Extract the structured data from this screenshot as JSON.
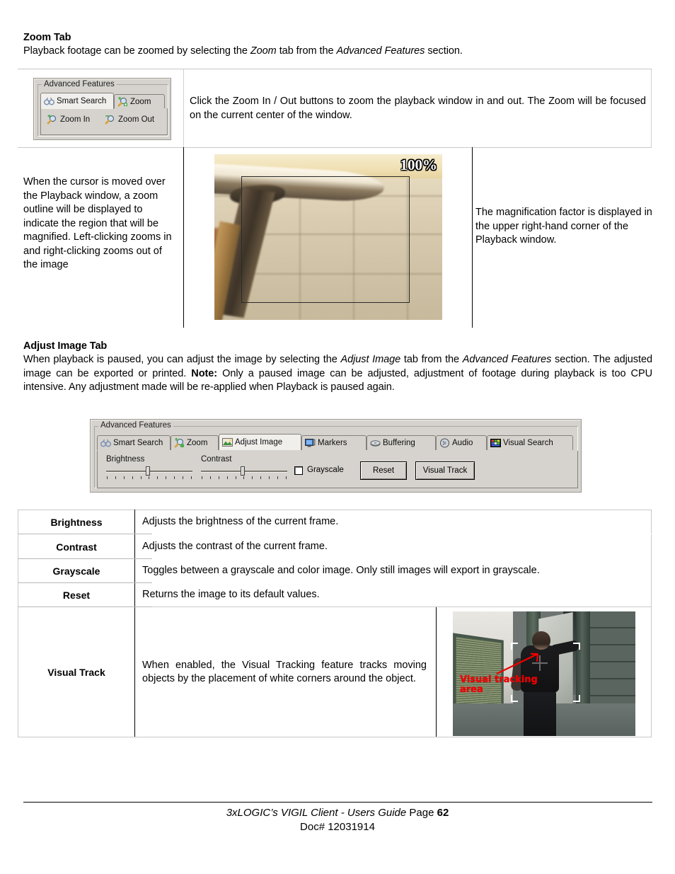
{
  "doc": {
    "zoom_section": {
      "heading": "Zoom Tab",
      "intro_pre": "Playback footage can be zoomed by selecting the ",
      "intro_em1": "Zoom",
      "intro_mid": " tab from the ",
      "intro_em2": "Advanced Features",
      "intro_post": " section."
    },
    "zoom_table": {
      "cell_toolbar_desc": "Click the Zoom In / Out buttons to zoom the playback window in and out.  The Zoom will be focused on the current center of the window.",
      "cell_cursor_desc": "When the cursor is moved over the Playback window, a zoom outline will be displayed to indicate the region that will be magnified. Left-clicking zooms in and right-clicking zooms out of the image",
      "cell_magnification_desc": "The magnification factor is displayed in the upper right-hand corner of the Playback window."
    },
    "adjust_section": {
      "heading": "Adjust Image Tab",
      "para_p1": "When playback is paused, you can adjust the image by selecting the ",
      "para_em1": "Adjust Image",
      "para_p2": " tab from the ",
      "para_em2": "Advanced Features",
      "para_p3": " section. The adjusted image can be exported or printed.  ",
      "para_note_label": "Note:",
      "para_p4": "  Only a paused image can be adjusted, adjustment of footage during playback is too CPU intensive.  Any adjustment made will be re-applied when Playback is paused again."
    }
  },
  "zoom_panel": {
    "legend": "Advanced Features",
    "tabs": [
      {
        "label": "Smart Search",
        "icon": "binoculars-icon",
        "active": false
      },
      {
        "label": "Zoom",
        "icon": "zoom-in-magnifier-icon",
        "active": true
      }
    ],
    "buttons": [
      {
        "label": "Zoom In",
        "icon": "zoom-in-magnifier-icon"
      },
      {
        "label": "Zoom Out",
        "icon": "zoom-out-magnifier-icon"
      }
    ]
  },
  "playback": {
    "magnification": "100%"
  },
  "adjust_panel": {
    "legend": "Advanced Features",
    "tabs": [
      {
        "label": "Smart Search",
        "icon": "binoculars-icon",
        "active": false
      },
      {
        "label": "Zoom",
        "icon": "zoom-in-magnifier-icon",
        "active": false
      },
      {
        "label": "Adjust Image",
        "icon": "picture-icon",
        "active": true
      },
      {
        "label": "Markers",
        "icon": "monitor-marker-icon",
        "active": false
      },
      {
        "label": "Buffering",
        "icon": "buffering-disc-icon",
        "active": false
      },
      {
        "label": "Audio",
        "icon": "audio-speaker-icon",
        "active": false
      },
      {
        "label": "Visual Search",
        "icon": "color-grid-icon",
        "active": false
      }
    ],
    "brightness_label": "Brightness",
    "contrast_label": "Contrast",
    "grayscale_label": "Grayscale",
    "grayscale_checked": false,
    "reset_label": "Reset",
    "visual_track_label": "Visual Track",
    "brightness_value_pct": 50,
    "contrast_value_pct": 50,
    "tick_count": 11
  },
  "adjust_table": {
    "rows": [
      {
        "label": "Brightness",
        "desc": "Adjusts the brightness of the current frame."
      },
      {
        "label": "Contrast",
        "desc": "Adjusts the contrast of the current frame."
      },
      {
        "label": "Grayscale",
        "desc": "Toggles between a grayscale and color image. Only still images will export in grayscale."
      },
      {
        "label": "Reset",
        "desc": "Returns the image to its default values."
      },
      {
        "label": "Visual Track",
        "desc": "When enabled, the Visual Tracking feature tracks moving objects by the placement of white corners around the object."
      }
    ]
  },
  "visual_track_image": {
    "annotation": "Visual tracking\narea",
    "annotation_color": "#ee0000"
  },
  "footer": {
    "line1_em": "3xLOGIC’s VIGIL Client - Users Guide",
    "line1_plain": " Page ",
    "line1_page": "62",
    "line2": "Doc# 12031914"
  }
}
